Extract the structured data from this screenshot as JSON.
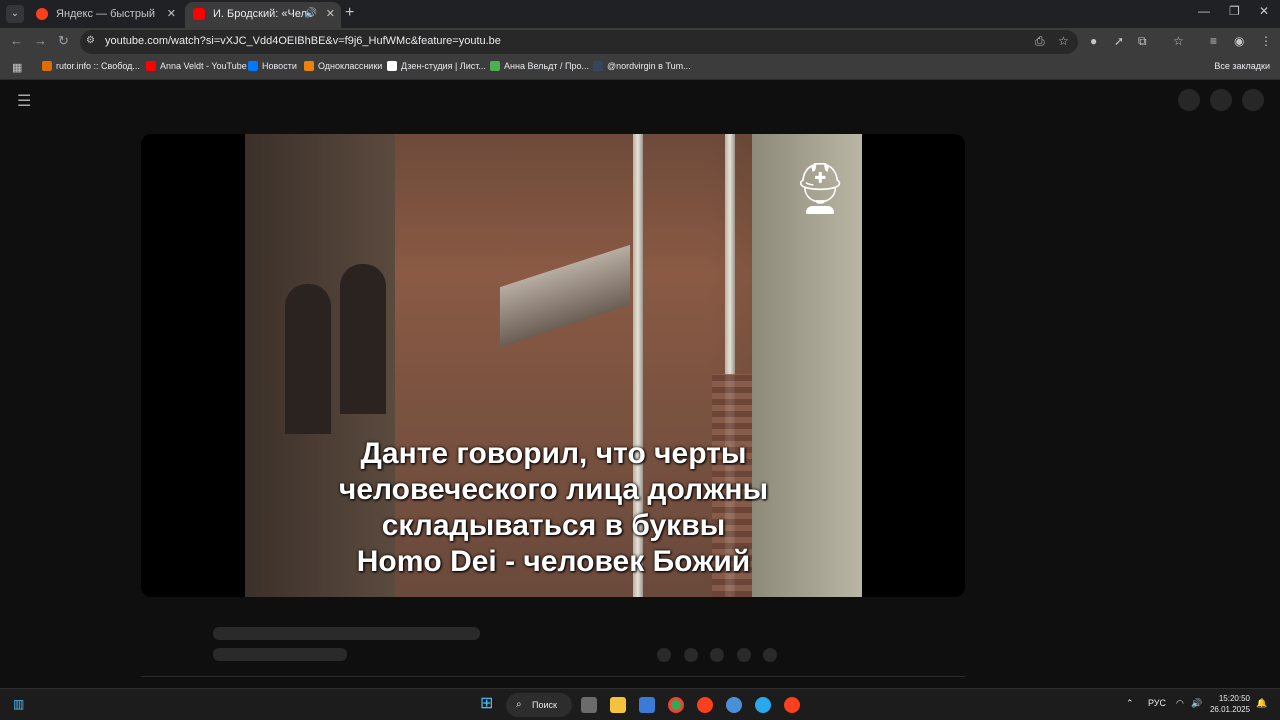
{
  "tabs": [
    {
      "label": "Яндекс — быстрый поиск в ин"
    },
    {
      "label": "И. Бродский: «Человек – с"
    }
  ],
  "tab_close": "✕",
  "new_tab": "+",
  "window_controls": {
    "minimize": "—",
    "restore": "❐",
    "close": "✕"
  },
  "toolbar": {
    "url": "youtube.com/watch?si=vXJC_Vdd4OEIBhBE&v=f9j6_HufWMc&feature=youtu.be"
  },
  "bookmarks": [
    {
      "label": "rutor.info :: Свобод...",
      "color": "#e06c00"
    },
    {
      "label": "Anna Veldt - YouTube",
      "color": "#ff0000"
    },
    {
      "label": "Новости",
      "color": "#0077ff"
    },
    {
      "label": "Одноклассники",
      "color": "#ee8208"
    },
    {
      "label": "Дзен-студия | Лист...",
      "color": "#ffffff"
    },
    {
      "label": "Анна Вельдт / Про...",
      "color": "#4caf50"
    },
    {
      "label": "@nordvirgin в Tum...",
      "color": "#35465c"
    }
  ],
  "bookmarks_all": "Все закладки",
  "video": {
    "subtitle_lines": [
      "Данте говорил, что черты",
      "человеческого лица должны",
      "складываться в буквы",
      "Homo Dei - человек Божий"
    ]
  },
  "taskbar": {
    "search_label": "Поиск",
    "lang": "РУС",
    "time": "15:20:50",
    "date": "26.01.2025"
  }
}
